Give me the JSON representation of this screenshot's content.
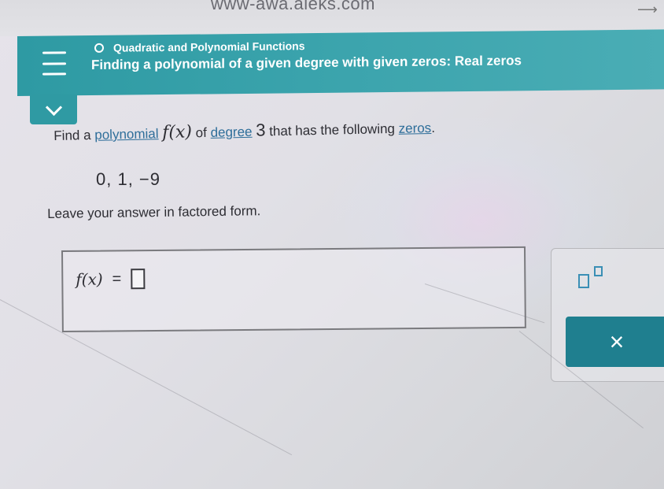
{
  "browser": {
    "url": "www-awa.aleks.com"
  },
  "header": {
    "topic": "Quadratic and Polynomial Functions",
    "lesson_title": "Finding a polynomial of a given degree with given zeros: Real zeros"
  },
  "question": {
    "part1": "Find a ",
    "link_polynomial": "polynomial",
    "func": "f(x)",
    "part2": " of ",
    "link_degree": "degree",
    "degree_value": "3",
    "part3": " that has the following ",
    "link_zeros": "zeros",
    "part4": ".",
    "zeros": "0, 1, −9",
    "instruction": "Leave your answer in factored form."
  },
  "answer": {
    "lhs": "f(x)",
    "equals": "="
  },
  "tools": {
    "clear_label": "×"
  },
  "colors": {
    "header_teal": "#2e9aa3",
    "link_blue": "#2e6e9a",
    "tool_blue": "#3a8fb5",
    "clear_button": "#1f7f8f"
  }
}
